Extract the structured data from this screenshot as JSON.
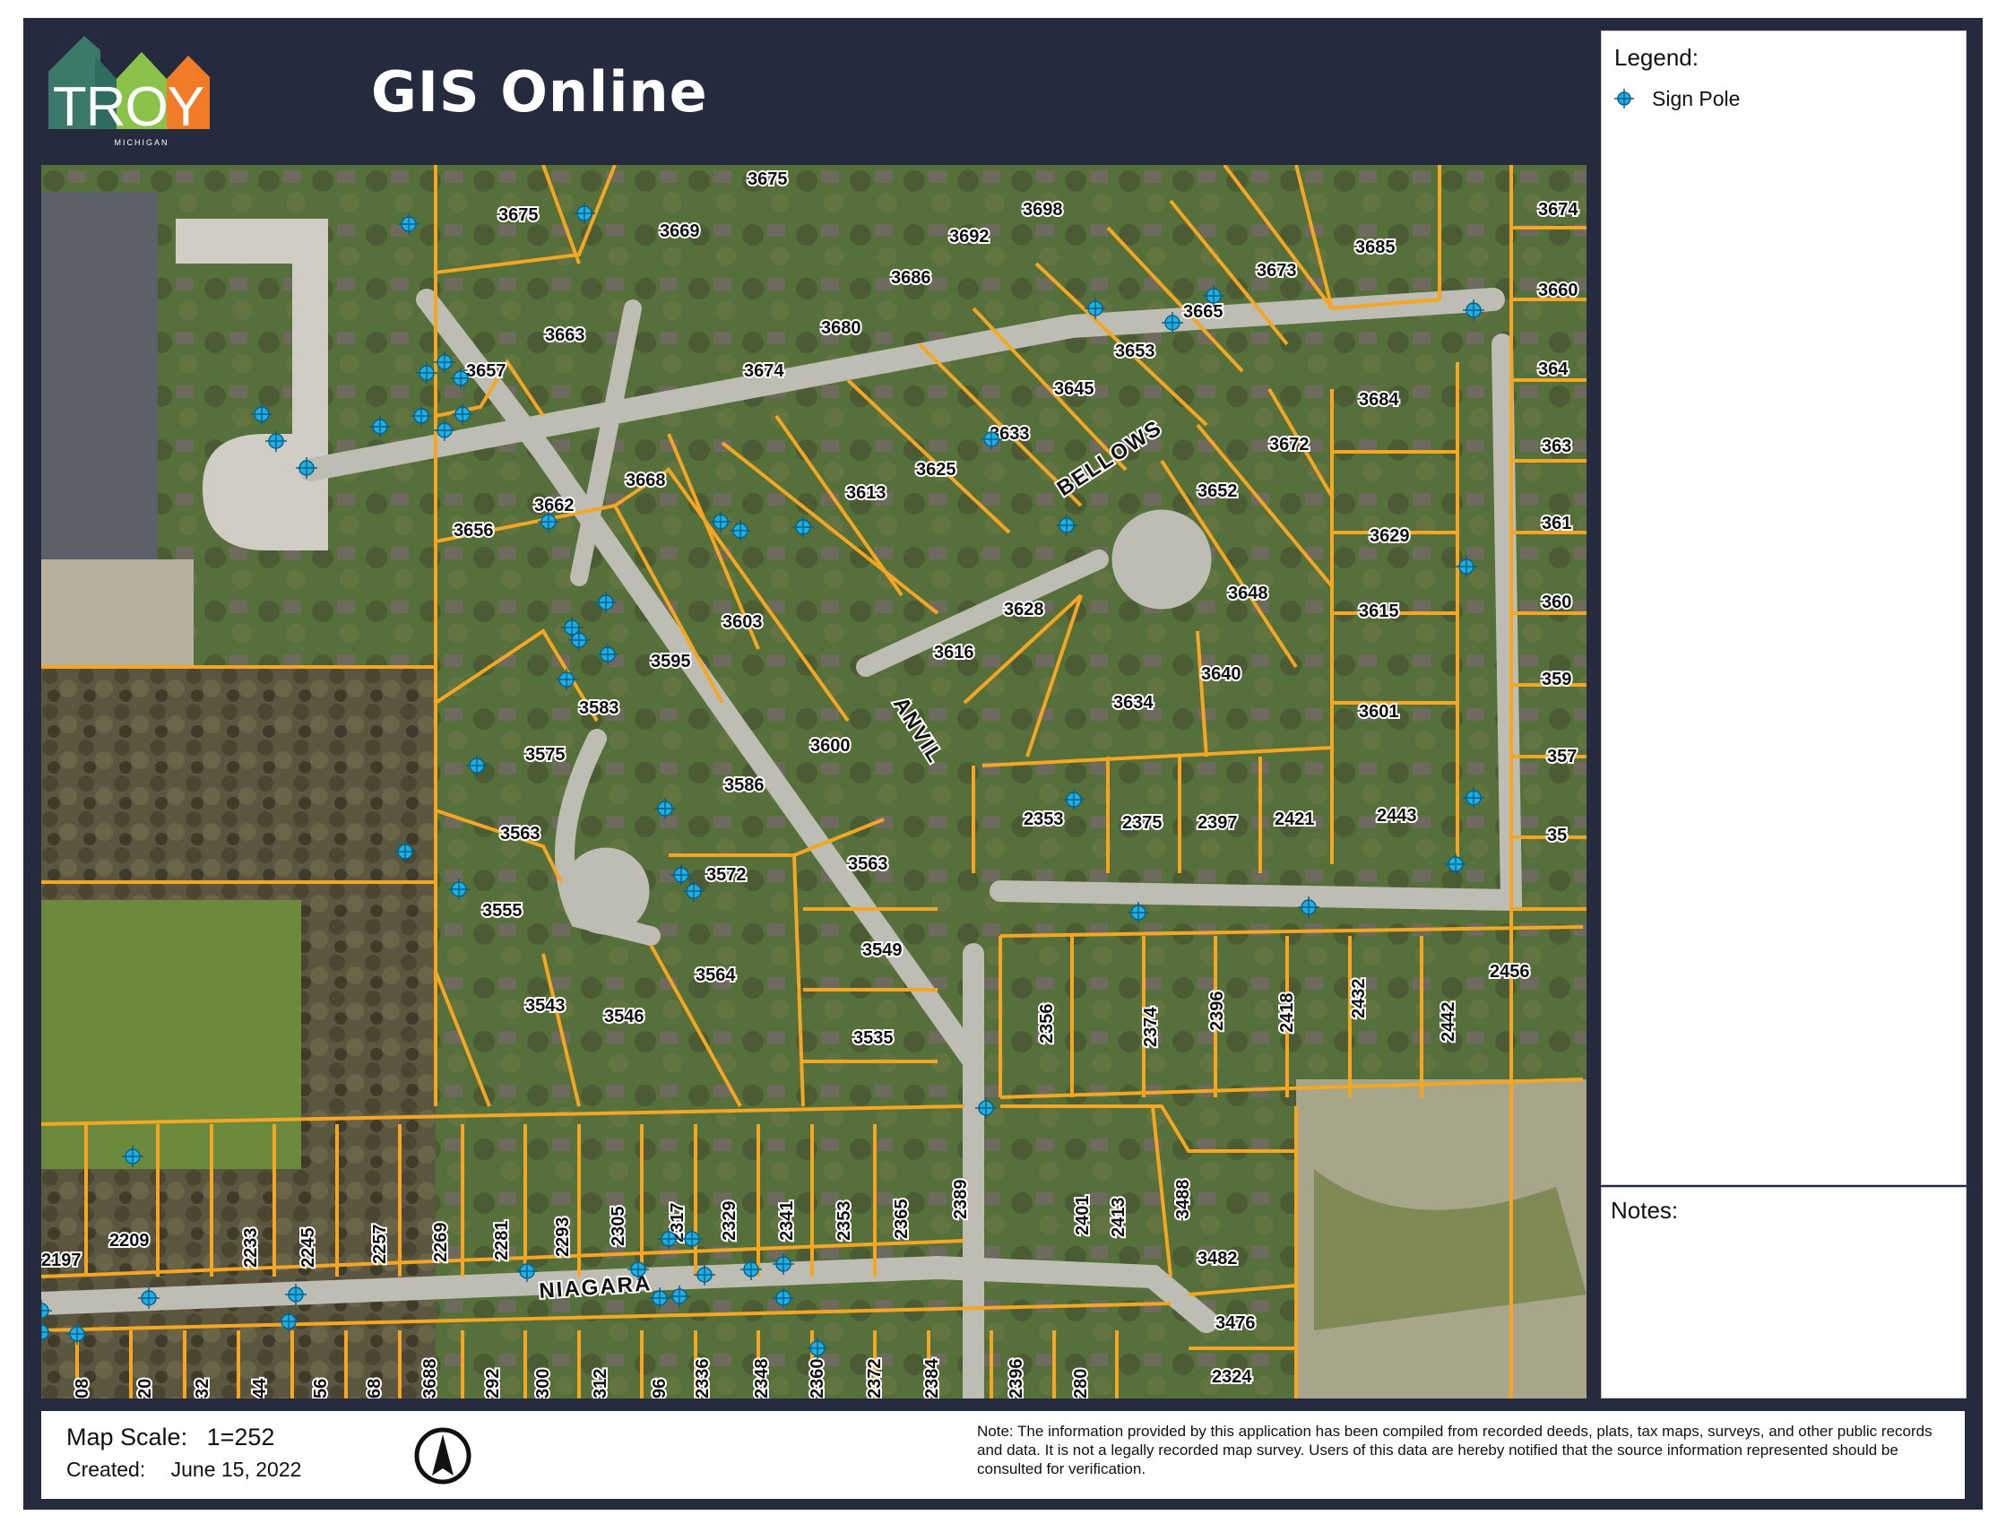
{
  "header": {
    "logo_text": "TROY",
    "logo_subtext": "MICHIGAN",
    "app_title": "GIS Online"
  },
  "legend": {
    "title": "Legend:",
    "items": [
      {
        "label": "Sign Pole",
        "icon": "sign-pole-icon",
        "color": "#1ab0e8"
      }
    ]
  },
  "notes": {
    "title": "Notes:"
  },
  "footer": {
    "scale_label": "Map Scale:",
    "scale_value": "1=252",
    "created_label": "Created:",
    "created_value": "June 15, 2022",
    "disclaimer": "Note: The information provided by this application has been compiled from recorded deeds, plats, tax maps, surveys, and other public records and data. It is not a legally recorded map survey. Users of this data are hereby notified that the source information represented should be consulted for verification."
  },
  "colors": {
    "frame": "#252a3d",
    "parcel_line": "#f5a623",
    "sign_pole": "#1ab0e8",
    "imagery_grass": "#5f7f3c",
    "imagery_trees": "#5a5540",
    "roads": "#bdbdb3"
  },
  "map": {
    "roads": [
      "BELLOWS",
      "ANVIL",
      "NIAGARA"
    ],
    "parcels": [
      "3675",
      "3669",
      "3675",
      "3698",
      "3692",
      "3686",
      "3663",
      "3657",
      "3680",
      "3674",
      "3685",
      "3673",
      "3665",
      "3653",
      "3645",
      "3633",
      "3625",
      "3613",
      "3668",
      "3662",
      "3656",
      "3672",
      "3652",
      "3684",
      "3629",
      "3615",
      "3648",
      "3640",
      "3628",
      "3603",
      "3595",
      "3616",
      "3583",
      "3634",
      "3601",
      "3575",
      "3600",
      "3586",
      "3563",
      "3572",
      "3563",
      "3555",
      "3543",
      "3546",
      "3564",
      "3549",
      "3535",
      "2353",
      "2375",
      "2397",
      "2421",
      "2443",
      "2456",
      "2356",
      "2374",
      "2396",
      "2418",
      "2432",
      "2442",
      "2209",
      "2197",
      "2233",
      "2245",
      "2257",
      "2269",
      "2281",
      "2293",
      "2305",
      "2317",
      "2329",
      "2341",
      "2353",
      "2365",
      "2389",
      "2401",
      "2413",
      "3488",
      "3482",
      "3476",
      "2324",
      "2336",
      "2348",
      "2360",
      "2372",
      "2384",
      "2396",
      "280",
      "292",
      "300",
      "312",
      "96",
      "08",
      "20",
      "32",
      "44",
      "56",
      "68",
      "3688",
      "3674",
      "3660",
      "364",
      "363",
      "361",
      "360",
      "359",
      "357",
      "35"
    ],
    "sign_pole_count": 58
  }
}
